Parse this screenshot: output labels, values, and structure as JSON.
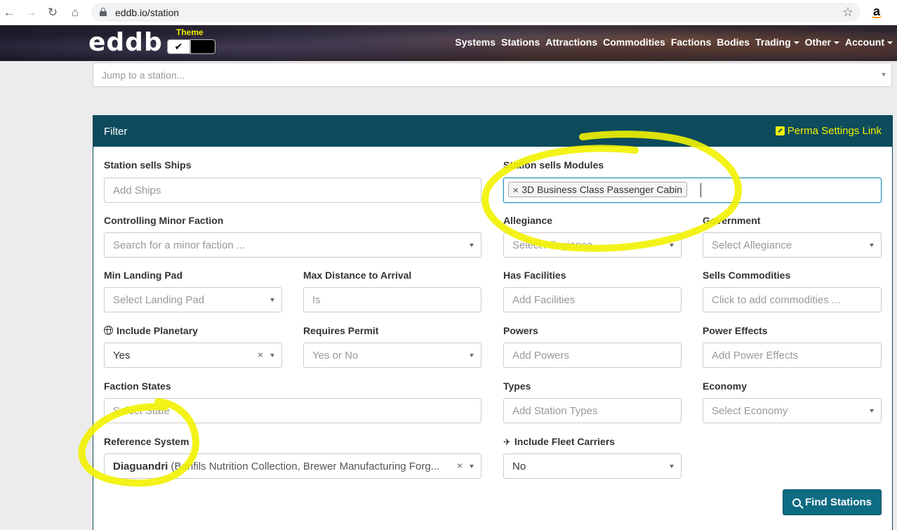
{
  "browser": {
    "url": "eddb.io/station"
  },
  "header": {
    "logo": "eddb",
    "theme_label": "Theme",
    "theme_light_check": "✔",
    "nav": [
      "Systems",
      "Stations",
      "Attractions",
      "Commodities",
      "Factions",
      "Bodies",
      "Trading",
      "Other",
      "Account"
    ]
  },
  "jump": {
    "placeholder": "Jump to a station..."
  },
  "filter": {
    "title": "Filter",
    "perma_link": "Perma Settings Link",
    "ships": {
      "label": "Station sells Ships",
      "placeholder": "Add Ships"
    },
    "modules": {
      "label": "Station sells Modules",
      "tag": "3D Business Class Passenger Cabin"
    },
    "faction": {
      "label": "Controlling Minor Faction",
      "placeholder": "Search for a minor faction ..."
    },
    "allegiance": {
      "label": "Allegiance",
      "placeholder": "Select Allegiance"
    },
    "government": {
      "label": "Government",
      "placeholder": "Select Allegiance"
    },
    "landing_pad": {
      "label": "Min Landing Pad",
      "placeholder": "Select Landing Pad"
    },
    "max_distance": {
      "label": "Max Distance to Arrival",
      "placeholder": "Is"
    },
    "facilities": {
      "label": "Has Facilities",
      "placeholder": "Add Facilities"
    },
    "commodities": {
      "label": "Sells Commodities",
      "placeholder": "Click to add commodities ..."
    },
    "planetary": {
      "label": "Include Planetary",
      "value": "Yes"
    },
    "permit": {
      "label": "Requires Permit",
      "placeholder": "Yes or No"
    },
    "powers": {
      "label": "Powers",
      "placeholder": "Add Powers"
    },
    "power_effects": {
      "label": "Power Effects",
      "placeholder": "Add Power Effects"
    },
    "faction_states": {
      "label": "Faction States",
      "placeholder": "Select State"
    },
    "types": {
      "label": "Types",
      "placeholder": "Add Station Types"
    },
    "economy": {
      "label": "Economy",
      "placeholder": "Select Economy"
    },
    "reference": {
      "label": "Reference System",
      "system": "Diaguandri",
      "detail": " (Bonfils Nutrition Collection, Brewer Manufacturing Forg..."
    },
    "fleet": {
      "label": "Include Fleet Carriers",
      "value": "No"
    },
    "find_button": "Find Stations"
  },
  "colors": {
    "panel_header": "#0d4b5d",
    "accent_yellow": "#f0f000",
    "button": "#0d6b82"
  },
  "icons": [
    "back-icon",
    "forward-icon",
    "reload-icon",
    "home-icon",
    "lock-icon",
    "star-icon",
    "amazon-icon",
    "globe-icon",
    "plane-icon",
    "search-icon",
    "external-link-icon"
  ]
}
